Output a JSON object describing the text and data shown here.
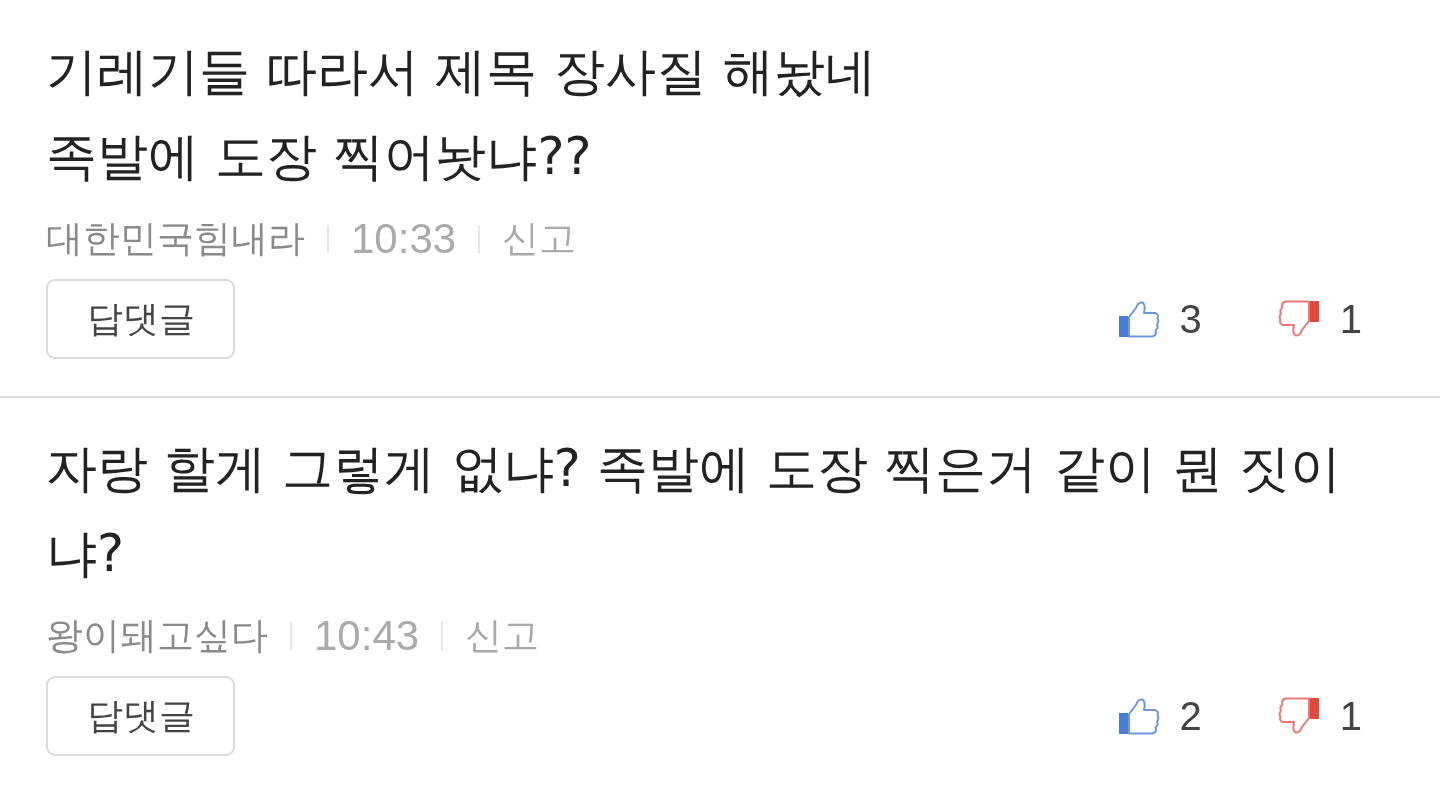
{
  "comments": [
    {
      "body_lines": [
        "기레기들 따라서 제목 장사질 해놨네",
        "족발에 도장 찍어놧냐??"
      ],
      "author": "대한민국힘내라",
      "time": "10:33",
      "report": "신고",
      "reply_button": "답댓글",
      "likes": "3",
      "dislikes": "1"
    },
    {
      "body_lines": [
        "자랑 할게 그렇게 없냐? 족발에 도장 찍은거 같이 뭔 짓이",
        "냐?"
      ],
      "author": "왕이돼고싶다",
      "time": "10:43",
      "report": "신고",
      "reply_button": "답댓글",
      "likes": "2",
      "dislikes": "1"
    }
  ]
}
